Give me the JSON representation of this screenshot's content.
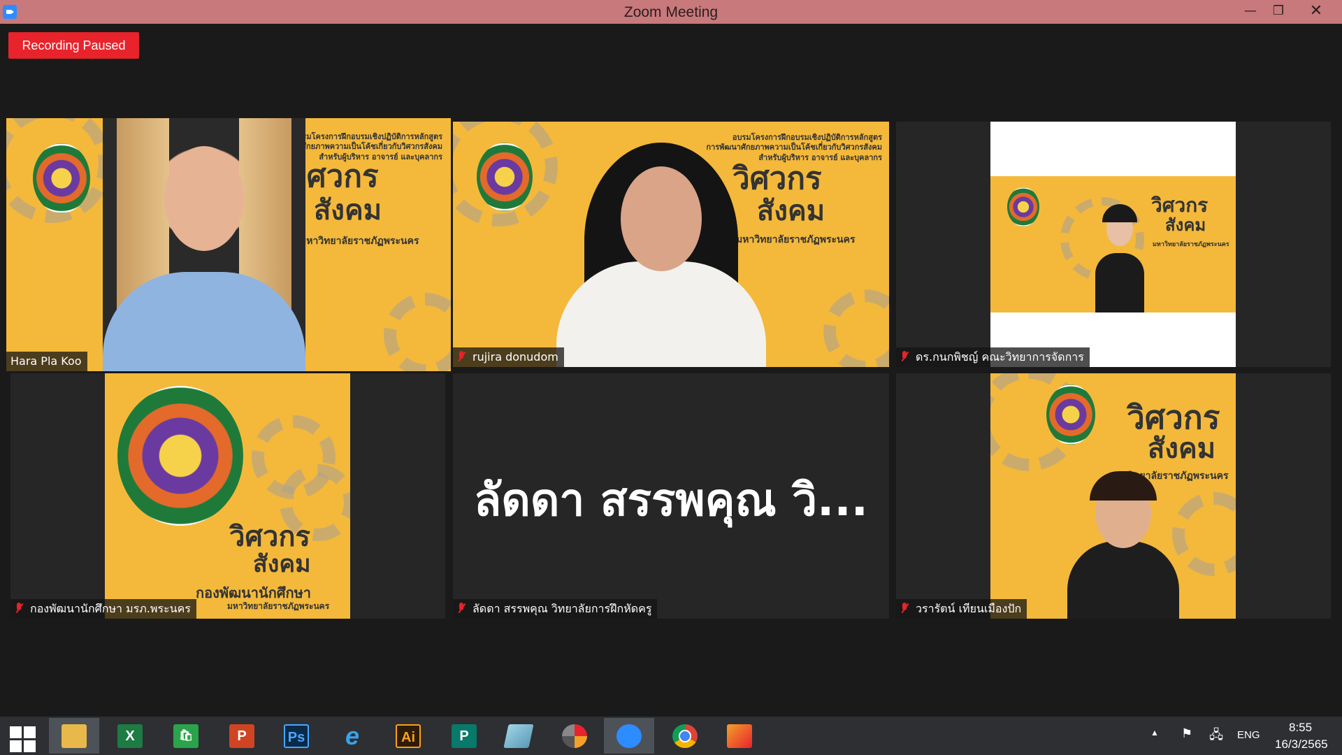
{
  "window": {
    "title": "Zoom Meeting",
    "controls": {
      "minimize": "—",
      "restore": "❐",
      "close": "✕"
    }
  },
  "recording_badge": "Recording Paused",
  "poster": {
    "heading_line1": "อบรมโครงการฝึกอบรมเชิงปฏิบัติการหลักสูตร",
    "heading_line2": "การพัฒนาศักยภาพความเป็นโค้ชเกี่ยวกับวิศวกรสังคม",
    "heading_line3": "สำหรับผู้บริหาร อาจารย์ และบุคลากร",
    "title_line1": "วิศวกร",
    "title_line2": "สังคม",
    "university": "มหาวิทยาลัยราชภัฏพระนคร",
    "division": "กองพัฒนานักศึกษา"
  },
  "participants": [
    {
      "name": "Hara Pla Koo",
      "muted": false,
      "active_speaker": true
    },
    {
      "name": "rujira donudom",
      "muted": true,
      "active_speaker": false
    },
    {
      "name": "ดร.กนกพิชญ์ คณะวิทยาการจัดการ",
      "muted": true,
      "active_speaker": false
    },
    {
      "name": "กองพัฒนานักศึกษา มรภ.พระนคร",
      "muted": true,
      "active_speaker": false
    },
    {
      "name": "ลัดดา สรรพคุณ วิทยาลัยการฝึกหัดครู",
      "muted": true,
      "active_speaker": false,
      "display_text": "ลัดดา สรรพคุณ วิ..."
    },
    {
      "name": "วรารัตน์ เทียนเมืองปัก",
      "muted": true,
      "active_speaker": false
    }
  ],
  "taskbar": {
    "apps": [
      {
        "name": "file-explorer",
        "label": ""
      },
      {
        "name": "excel",
        "label": "X"
      },
      {
        "name": "store",
        "label": "🛍"
      },
      {
        "name": "powerpoint",
        "label": "P"
      },
      {
        "name": "photoshop",
        "label": "Ps"
      },
      {
        "name": "internet-explorer",
        "label": "e"
      },
      {
        "name": "illustrator",
        "label": "Ai"
      },
      {
        "name": "publisher",
        "label": "P"
      },
      {
        "name": "notepad",
        "label": ""
      },
      {
        "name": "photoscape",
        "label": ""
      },
      {
        "name": "zoom",
        "label": ""
      },
      {
        "name": "chrome",
        "label": ""
      },
      {
        "name": "photos",
        "label": ""
      }
    ],
    "tray": {
      "language": "ENG",
      "time": "8:55",
      "date": "16/3/2565"
    }
  },
  "colors": {
    "title_bar": "#c8797b",
    "recording": "#e8232b",
    "active_speaker_border": "#b4e24a",
    "poster_yellow": "#f4b93b",
    "taskbar": "#2d2f33"
  }
}
